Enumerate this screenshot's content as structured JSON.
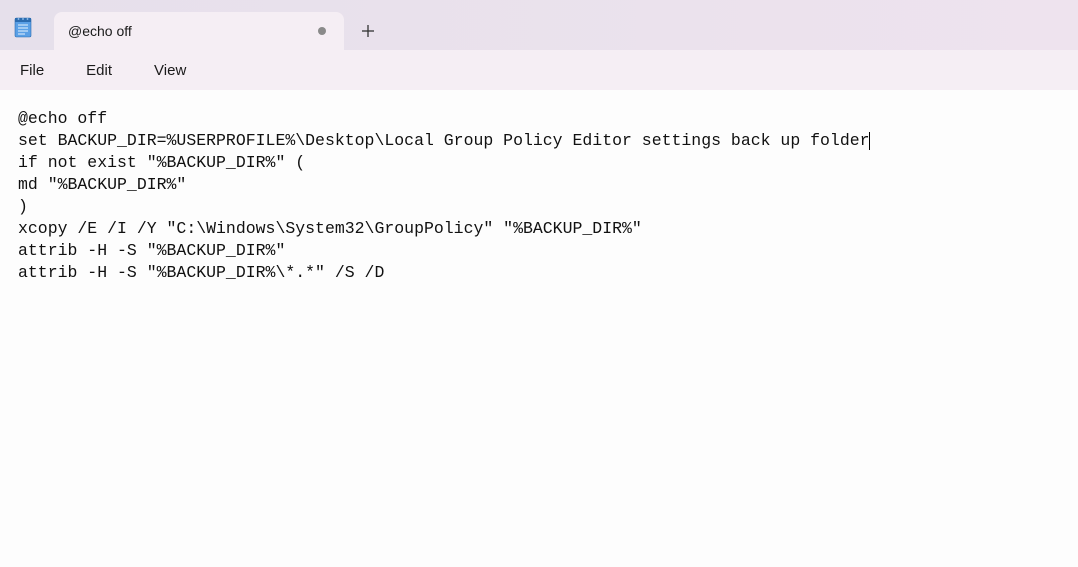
{
  "titlebar": {
    "tab_title": "@echo off",
    "modified": true
  },
  "menubar": {
    "file": "File",
    "edit": "Edit",
    "view": "View"
  },
  "editor": {
    "lines": [
      "@echo off",
      "set BACKUP_DIR=%USERPROFILE%\\Desktop\\Local Group Policy Editor settings back up folder",
      "if not exist \"%BACKUP_DIR%\" (",
      "md \"%BACKUP_DIR%\"",
      ")",
      "xcopy /E /I /Y \"C:\\Windows\\System32\\GroupPolicy\" \"%BACKUP_DIR%\"",
      "attrib -H -S \"%BACKUP_DIR%\"",
      "attrib -H -S \"%BACKUP_DIR%\\*.*\" /S /D"
    ],
    "caret_line": 1
  }
}
